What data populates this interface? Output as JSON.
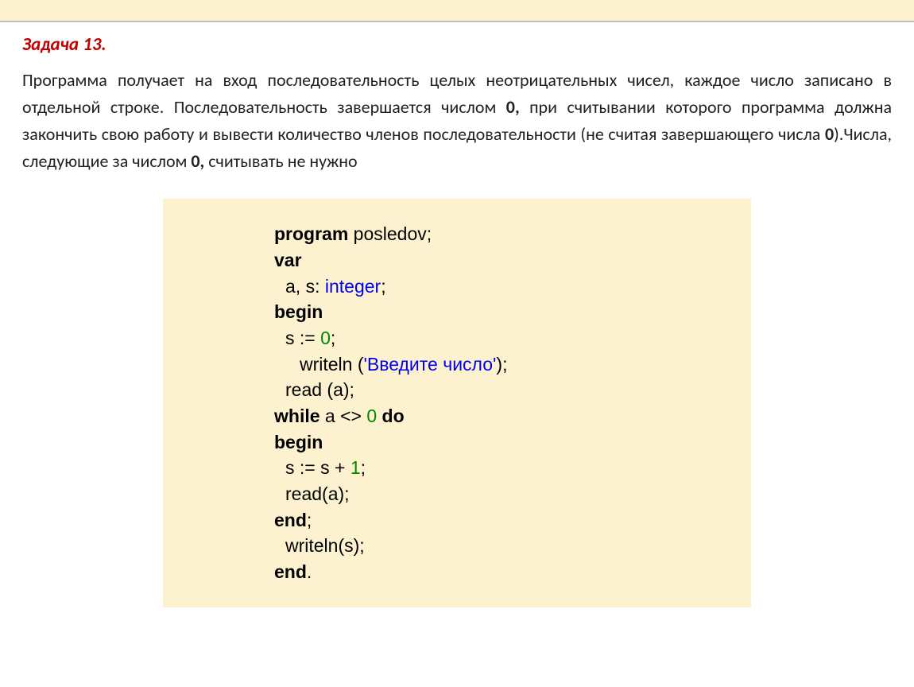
{
  "task": {
    "title": "Задача 13.",
    "desc_parts": {
      "t1": "Программа получает на вход последовательность целых неотрицательных чисел, каждое число записано в отдельной строке. Последовательность завершается числом ",
      "b1": "0,",
      "t2": " при считывании которого программа должна закончить свою работу и вывести количество членов последовательности (не считая завершающего числа ",
      "b2": "0",
      "t3": ").Числа, следующие за числом ",
      "b3": "0,",
      "t4": " считывать не нужно"
    }
  },
  "code": {
    "kw_program": "program",
    "prog_name": " posledov;",
    "kw_var": "var",
    "decl_vars": "a, s: ",
    "type_int": "integer",
    "semicolon": ";",
    "kw_begin": "begin",
    "assign_s0_a": "s := ",
    "num_0": "0",
    "writeln_open": "writeln (",
    "str_input": "'Введите число'",
    "close_paren_sc": ");",
    "read_a": "read (a);",
    "kw_while": "while",
    "while_mid": " a <> ",
    "space": " ",
    "kw_do": "do",
    "assign_s_inc_a": "s := s + ",
    "num_1": "1",
    "read_a2": "read(a);",
    "kw_end": "end",
    "writeln_s": "writeln(s);",
    "dot": "."
  }
}
